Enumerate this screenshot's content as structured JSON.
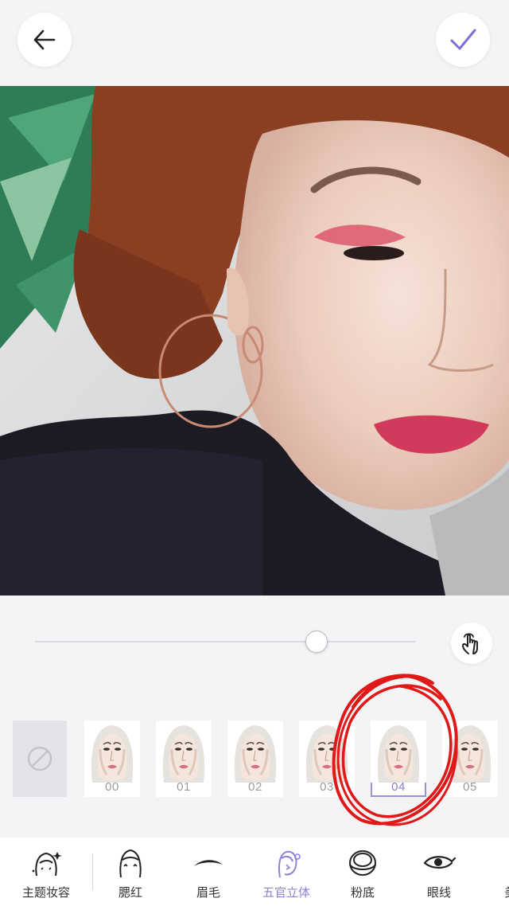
{
  "header": {
    "back_icon": "arrow-left-icon",
    "confirm_icon": "checkmark-icon",
    "accent": "#7b6fd4"
  },
  "photo": {
    "subject": "selfie-photo"
  },
  "intensity_slider": {
    "value": 0.74
  },
  "touch_icon": "hand-touch-icon",
  "styles": {
    "none_icon": "none-circle-slash-icon",
    "items": [
      {
        "label": "00"
      },
      {
        "label": "01"
      },
      {
        "label": "02"
      },
      {
        "label": "03"
      },
      {
        "label": "04"
      },
      {
        "label": "05"
      }
    ],
    "selected": "04",
    "selected_color": "#9c8ed8"
  },
  "annotation_color": "#e01818",
  "bottom_nav": {
    "items": [
      {
        "label": "主题妆容",
        "icon": "makeup-theme-icon"
      },
      {
        "label": "腮红",
        "icon": "blush-face-icon"
      },
      {
        "label": "眉毛",
        "icon": "eyebrow-icon"
      },
      {
        "label": "五官立体",
        "icon": "contour-face-icon"
      },
      {
        "label": "粉底",
        "icon": "foundation-compact-icon"
      },
      {
        "label": "眼线",
        "icon": "eyeliner-icon"
      },
      {
        "label": "美",
        "icon": "more-icon"
      }
    ],
    "active": "五官立体",
    "active_color": "#8e82d6"
  }
}
